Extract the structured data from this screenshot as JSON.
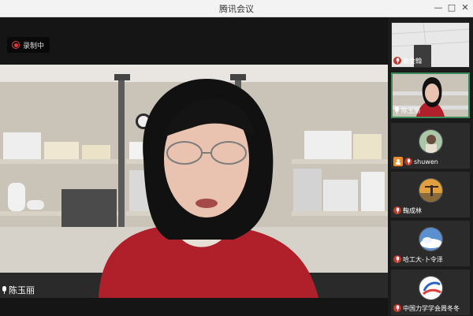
{
  "window": {
    "title": "腾讯会议"
  },
  "recording": {
    "label": "录制中"
  },
  "main_speaker": {
    "name": "陈玉丽"
  },
  "participants": [
    {
      "name": "谢金翰",
      "kind": "camera"
    },
    {
      "name": "陈玉丽",
      "kind": "camera",
      "active": true
    },
    {
      "name": "shuwen",
      "kind": "avatar"
    },
    {
      "name": "鞠成林",
      "kind": "avatar"
    },
    {
      "name": "哈工大-卜令泽",
      "kind": "avatar"
    },
    {
      "name": "中国力学学会周冬冬",
      "kind": "avatar"
    }
  ],
  "colors": {
    "accent_active": "#3c8b5a",
    "recording_red": "#e03b3b",
    "muted_red": "#c0392b"
  },
  "icons": {
    "recording": "record-dot-icon",
    "mic": "microphone-icon",
    "minimize": "minimize-icon",
    "maximize": "maximize-icon",
    "close": "close-icon"
  }
}
